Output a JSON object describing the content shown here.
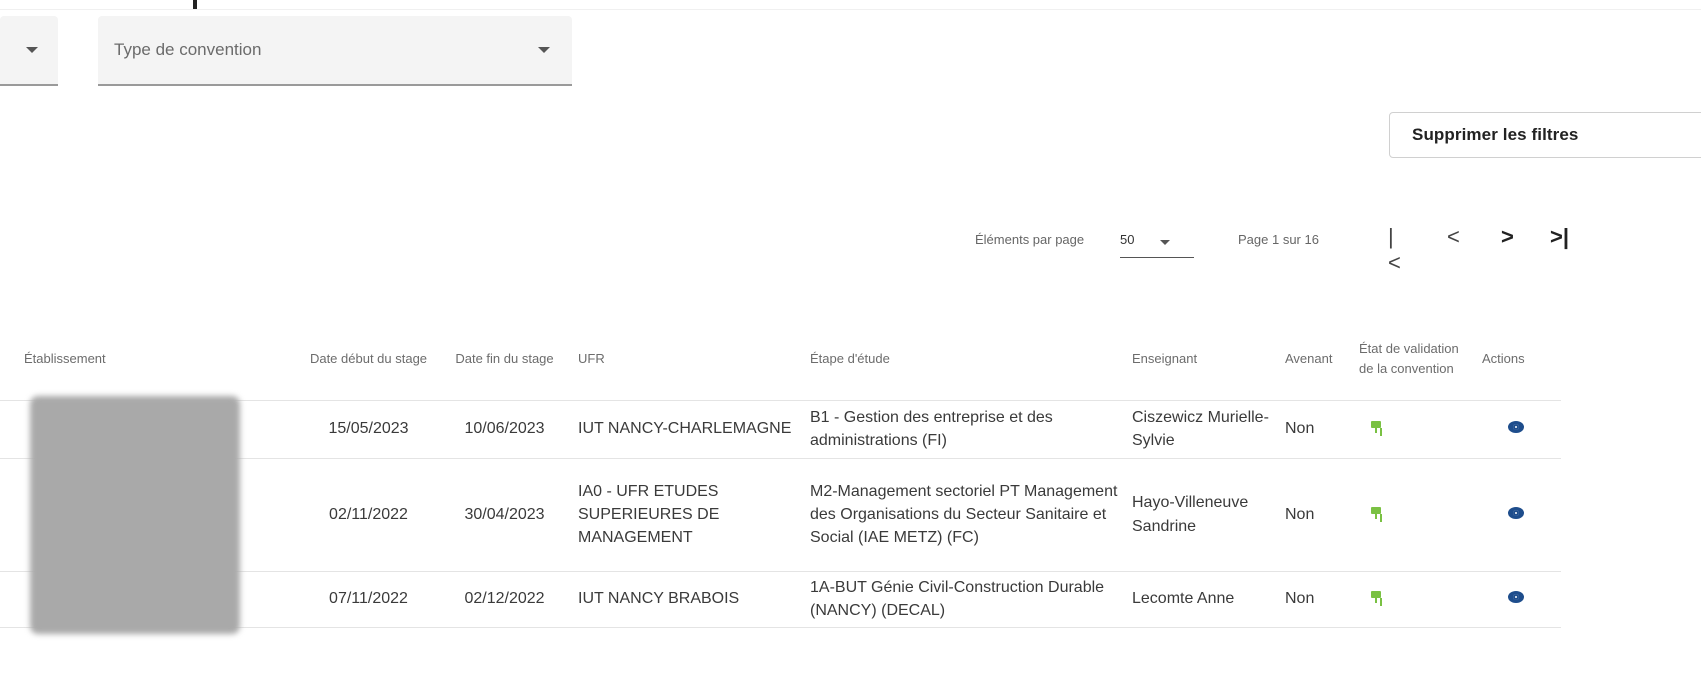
{
  "filters": {
    "type_convention_label": "Type de convention"
  },
  "clear_filters_label": "Supprimer les filtres",
  "pagination": {
    "items_per_page_label": "Éléments par page",
    "items_per_page_value": "50",
    "page_info": "Page 1 sur 16",
    "first_icon": "|<",
    "prev_icon": "<",
    "next_icon": ">",
    "last_icon": ">|"
  },
  "table": {
    "headers": {
      "etablissement": "Établissement",
      "date_debut": "Date début du stage",
      "date_fin": "Date fin du stage",
      "ufr": "UFR",
      "etape": "Étape d'étude",
      "enseignant": "Enseignant",
      "avenant": "Avenant",
      "etat": "État de validation de la convention",
      "actions": "Actions"
    },
    "rows": [
      {
        "date_debut": "15/05/2023",
        "date_fin": "10/06/2023",
        "ufr": "IUT NANCY-CHARLEMAGNE",
        "etape": "B1 - Gestion des entreprise et des administrations (FI)",
        "enseignant": "Ciszewicz Murielle-Sylvie",
        "avenant": "Non"
      },
      {
        "date_debut": "02/11/2022",
        "date_fin": "30/04/2023",
        "ufr": "IA0 - UFR ETUDES SUPERIEURES DE MANAGEMENT",
        "etape": "M2-Management sectoriel PT Management des Organisations du Secteur Sanitaire et Social (IAE METZ) (FC)",
        "enseignant": "Hayo-Villeneuve Sandrine",
        "avenant": "Non"
      },
      {
        "date_debut": "07/11/2022",
        "date_fin": "02/12/2022",
        "ufr": "IUT NANCY BRABOIS",
        "etape": "1A-BUT Génie Civil-Construction Durable (NANCY) (DECAL)",
        "enseignant": "Lecomte Anne",
        "avenant": "Non"
      }
    ]
  },
  "icons": {
    "validation_state": "validated-flag-icon",
    "view": "eye-icon"
  },
  "colors": {
    "validated": "#7ac143",
    "view_icon": "#1e4d8c"
  }
}
